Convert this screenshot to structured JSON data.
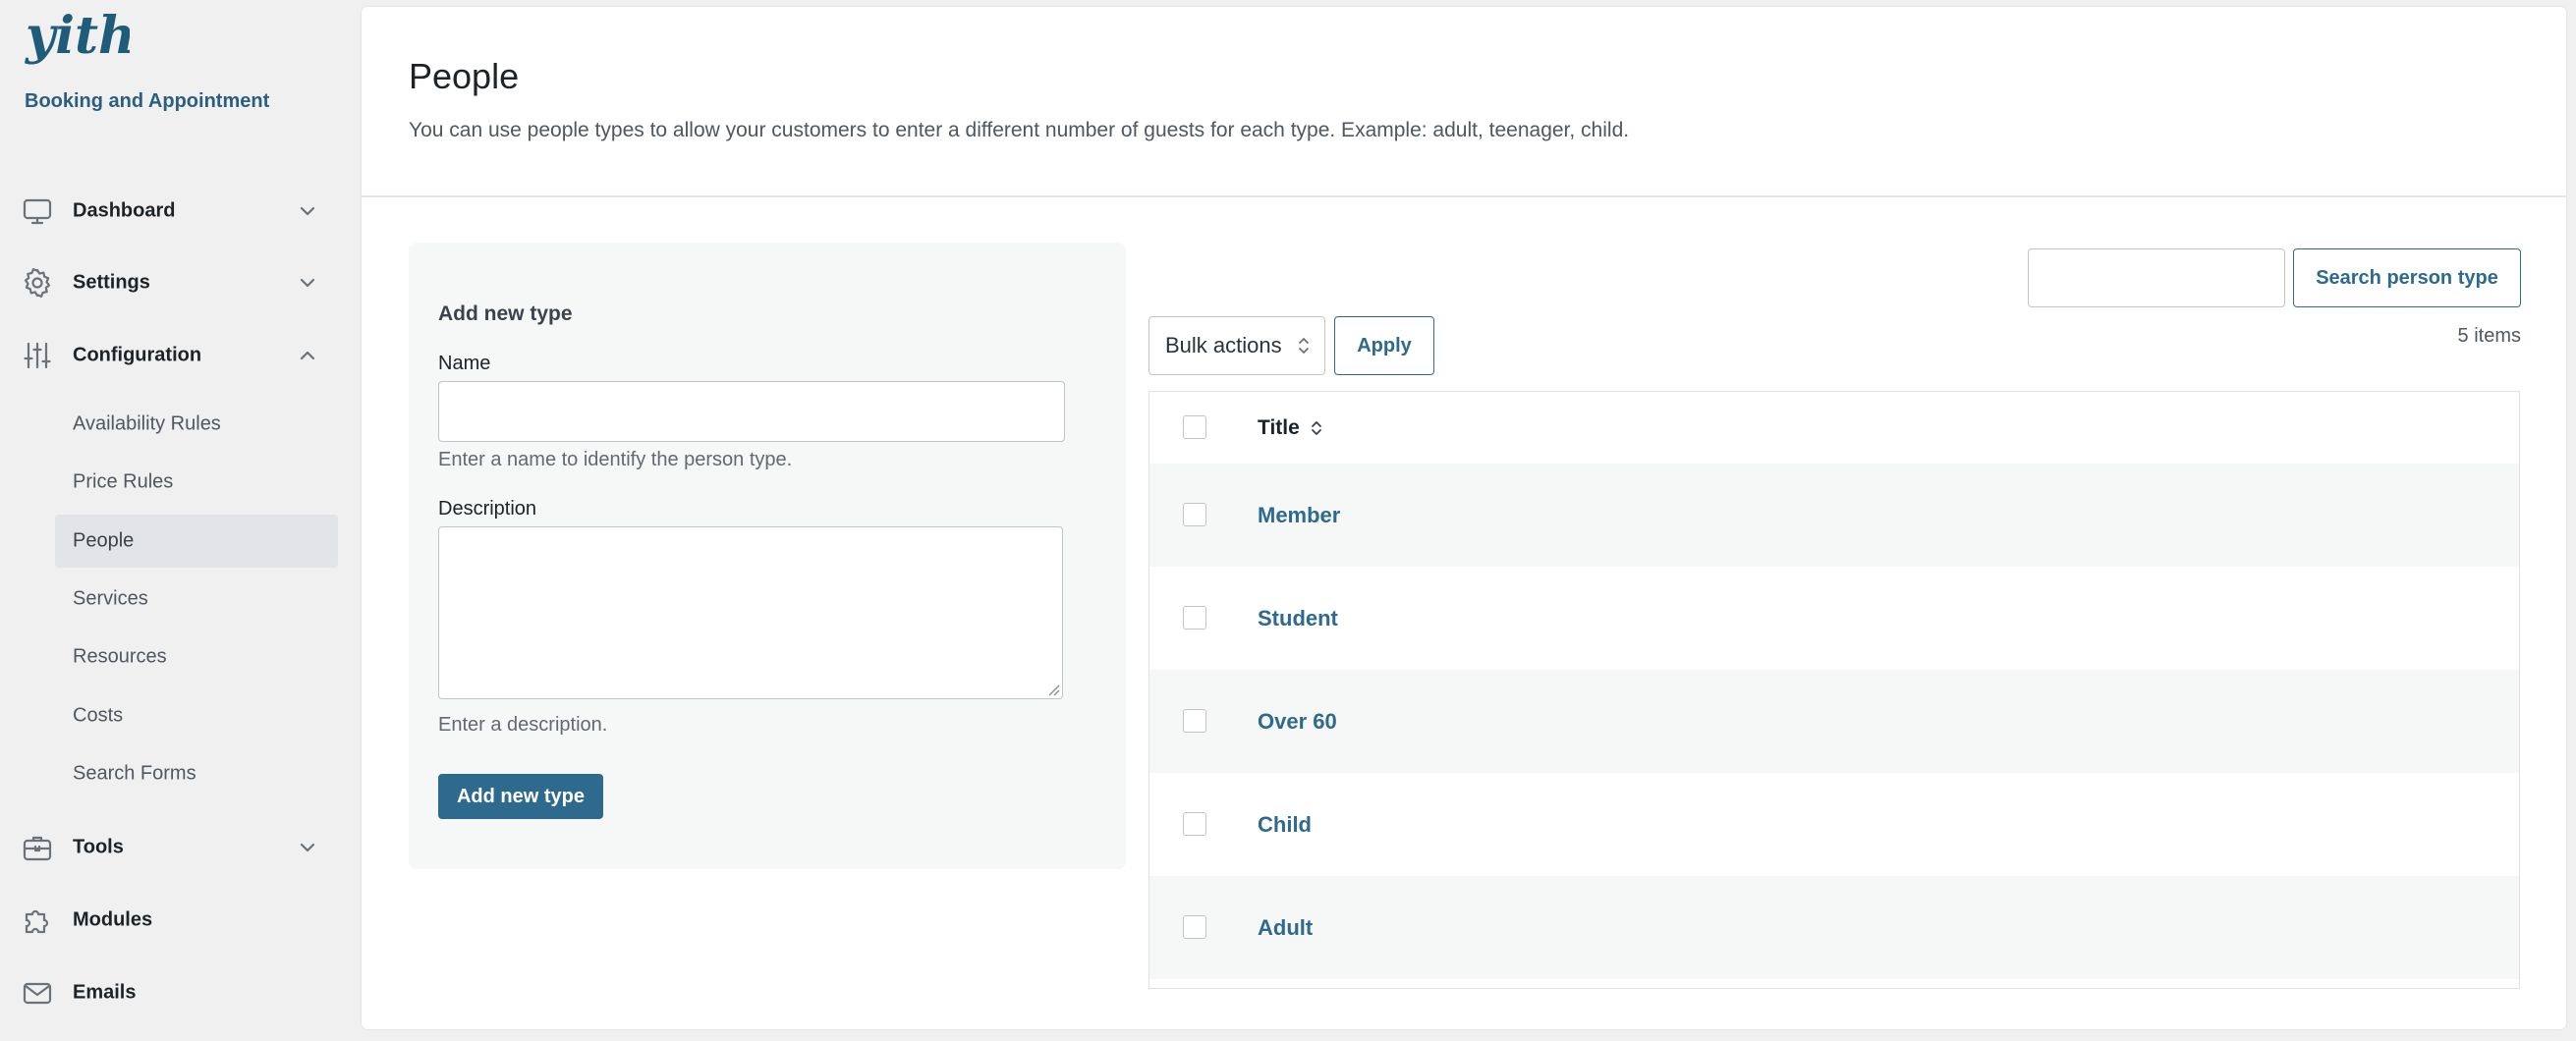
{
  "brand": {
    "logo_text": "yith",
    "plugin_name": "Booking and Appointment"
  },
  "sidebar": {
    "items": [
      {
        "label": "Dashboard",
        "icon": "monitor-icon",
        "chevron": "chevron-down-icon"
      },
      {
        "label": "Settings",
        "icon": "gear-icon",
        "chevron": "chevron-down-icon"
      },
      {
        "label": "Configuration",
        "icon": "sliders-icon",
        "chevron": "chevron-up-icon"
      },
      {
        "label": "Tools",
        "icon": "toolbox-icon",
        "chevron": "chevron-down-icon"
      },
      {
        "label": "Modules",
        "icon": "puzzle-icon"
      },
      {
        "label": "Emails",
        "icon": "envelope-icon"
      }
    ],
    "configuration_subitems": [
      {
        "label": "Availability Rules"
      },
      {
        "label": "Price Rules"
      },
      {
        "label": "People",
        "active": true
      },
      {
        "label": "Services"
      },
      {
        "label": "Resources"
      },
      {
        "label": "Costs"
      },
      {
        "label": "Search Forms"
      }
    ]
  },
  "page": {
    "title": "People",
    "description": "You can use people types to allow your customers to enter a different number of guests for each type. Example: adult, teenager, child."
  },
  "form": {
    "title": "Add new type",
    "name_label": "Name",
    "name_value": "",
    "name_help": "Enter a name to identify the person type.",
    "description_label": "Description",
    "description_value": "",
    "description_help": "Enter a description.",
    "submit_label": "Add new type"
  },
  "list": {
    "search_value": "",
    "search_button": "Search person type",
    "bulk_actions_label": "Bulk actions",
    "apply_label": "Apply",
    "items_count": "5 items",
    "column_title": "Title",
    "rows": [
      {
        "title": "Member"
      },
      {
        "title": "Student"
      },
      {
        "title": "Over 60"
      },
      {
        "title": "Child"
      },
      {
        "title": "Adult"
      }
    ]
  },
  "colors": {
    "accent": "#2e6a8e",
    "brand_logo": "#1f5c7a",
    "active_nav_bg": "#e2e4e7",
    "sidebar_bg": "#f0f0f1",
    "alt_row_bg": "#f6f7f7"
  }
}
